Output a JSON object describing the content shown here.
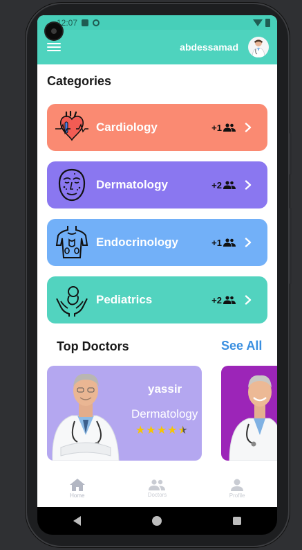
{
  "status": {
    "time": "12:07"
  },
  "app": {
    "username": "abdessamad"
  },
  "categories_title": "Categories",
  "categories": [
    {
      "name": "Cardiology",
      "count": "+1",
      "color": "#fa8a72"
    },
    {
      "name": "Dermatology",
      "count": "+2",
      "color": "#8a77f0"
    },
    {
      "name": "Endocrinology",
      "count": "+1",
      "color": "#72b0f8"
    },
    {
      "name": "Pediatrics",
      "count": "+2",
      "color": "#52d3bf"
    }
  ],
  "top_doctors": {
    "title": "Top Doctors",
    "see_all": "See All",
    "doctors": [
      {
        "name": "yassir",
        "specialty": "Dermatology",
        "rating": 4.5,
        "color": "#b4a7f0"
      },
      {
        "color": "#9c25b8"
      }
    ]
  },
  "nav": {
    "home": "Home",
    "doctors": "Doctors",
    "profile": "Profile"
  },
  "colors": {
    "appbar": "#4ed3be",
    "accent": "#3a8fe0"
  }
}
